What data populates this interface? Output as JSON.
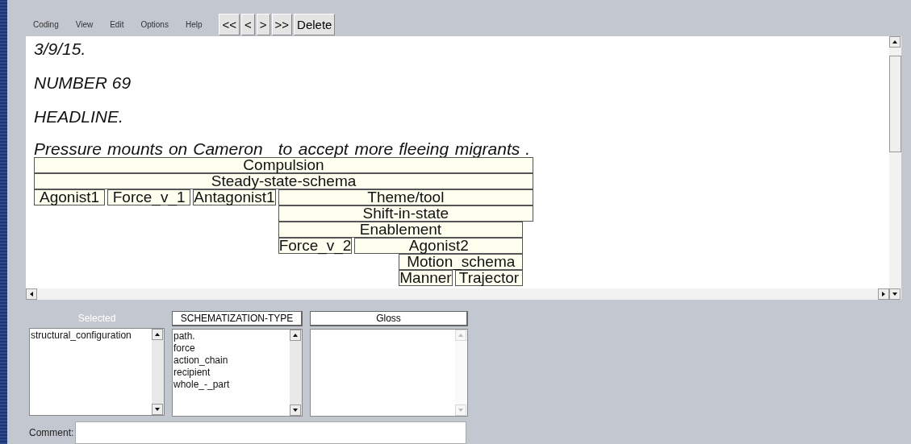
{
  "menu": [
    "Coding",
    "View",
    "Edit",
    "Options",
    "Help"
  ],
  "nav_buttons": [
    "<<",
    "<",
    ">",
    ">>",
    "Delete"
  ],
  "document": {
    "lines": [
      "3/9/15.",
      "NUMBER 69",
      "HEADLINE."
    ],
    "sentence": [
      "Pressure",
      "mounts",
      "on",
      "Cameron",
      "to",
      "accept",
      "more",
      "fleeing",
      "migrants",
      "."
    ],
    "annotation_rows": [
      [
        "Compulsion"
      ],
      [
        "Steady-state-schema"
      ],
      [
        "Agonist1",
        "Force_v_1",
        "Antagonist1",
        "Theme/tool"
      ],
      [
        "Shift-in-state"
      ],
      [
        "Enablement"
      ],
      [
        "Force_v_2",
        "Agonist2"
      ],
      [
        "Motion_schema"
      ],
      [
        "Manner",
        "Trajector"
      ]
    ]
  },
  "panels": [
    {
      "kind": "label",
      "header": "Selected",
      "items": [
        "structural_configuration"
      ],
      "disabled": false
    },
    {
      "kind": "button",
      "header": "SCHEMATIZATION-TYPE",
      "items": [
        "path.",
        "force",
        "action_chain",
        "recipient",
        "whole_-_part"
      ],
      "disabled": false
    },
    {
      "kind": "button",
      "header": "Gloss",
      "disabled": true
    }
  ],
  "comment": {
    "label": "Comment:"
  }
}
